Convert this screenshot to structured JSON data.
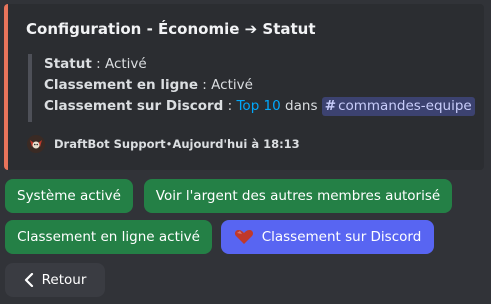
{
  "embed": {
    "accent_color": "#e8745b",
    "title": "Configuration - Économie ➔ Statut",
    "status_label": "Statut",
    "status_value": " : Activé",
    "online_label": "Classement en ligne",
    "online_value": " : Activé",
    "discord_label": "Classement sur Discord",
    "discord_sep": " : ",
    "discord_link": "Top 10",
    "discord_in": " dans ",
    "channel_hash": "#",
    "channel_name": "commandes-equipe",
    "footer_bot": "DraftBot Support",
    "footer_sep": " • ",
    "footer_time": "Aujourd'hui à 18:13",
    "footer_icon": "draftbot-avatar-icon"
  },
  "buttons": {
    "system": "Système activé",
    "view_money": "Voir l'argent des autres membres autorisé",
    "online_ranking": "Classement en ligne activé",
    "discord_ranking": "Classement sur Discord",
    "discord_ranking_icon": "heart-icon",
    "back": "Retour",
    "back_icon": "chevron-left-icon"
  },
  "colors": {
    "success": "#248046",
    "primary": "#5865f2",
    "secondary": "#3a3c42"
  }
}
